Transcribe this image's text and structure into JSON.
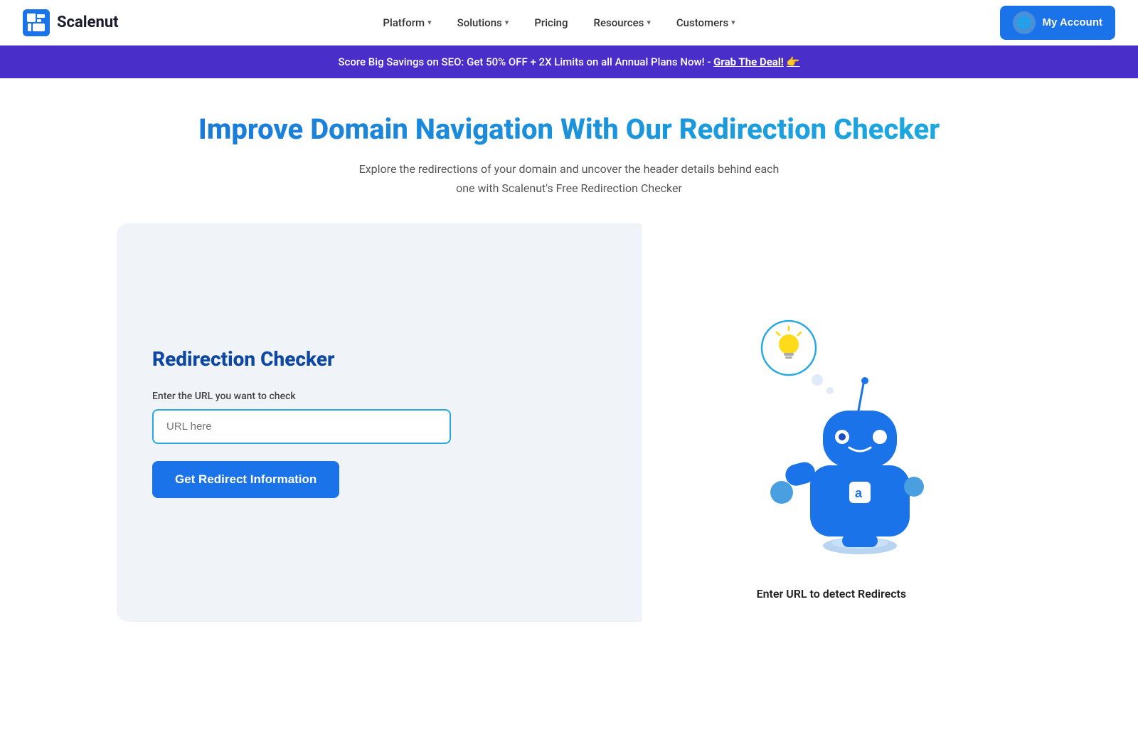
{
  "navbar": {
    "logo_text": "Scalenut",
    "nav_items": [
      {
        "label": "Platform",
        "has_chevron": true
      },
      {
        "label": "Solutions",
        "has_chevron": true
      },
      {
        "label": "Pricing",
        "has_chevron": false
      },
      {
        "label": "Resources",
        "has_chevron": true
      },
      {
        "label": "Customers",
        "has_chevron": true
      }
    ],
    "account_label": "My Account"
  },
  "banner": {
    "text": "Score Big Savings on SEO: Get 50% OFF + 2X Limits on all Annual Plans Now! - ",
    "cta": "Grab The Deal!",
    "emoji": "👉"
  },
  "hero": {
    "title": "Improve Domain Navigation With Our Redirection Checker",
    "subtitle": "Explore the redirections of your domain and uncover the header details behind each one with Scalenut's Free Redirection Checker"
  },
  "checker": {
    "title": "Redirection Checker",
    "input_label": "Enter the URL you want to check",
    "input_placeholder": "URL here",
    "button_label": "Get Redirect Information",
    "robot_caption": "Enter URL to detect Redirects"
  }
}
